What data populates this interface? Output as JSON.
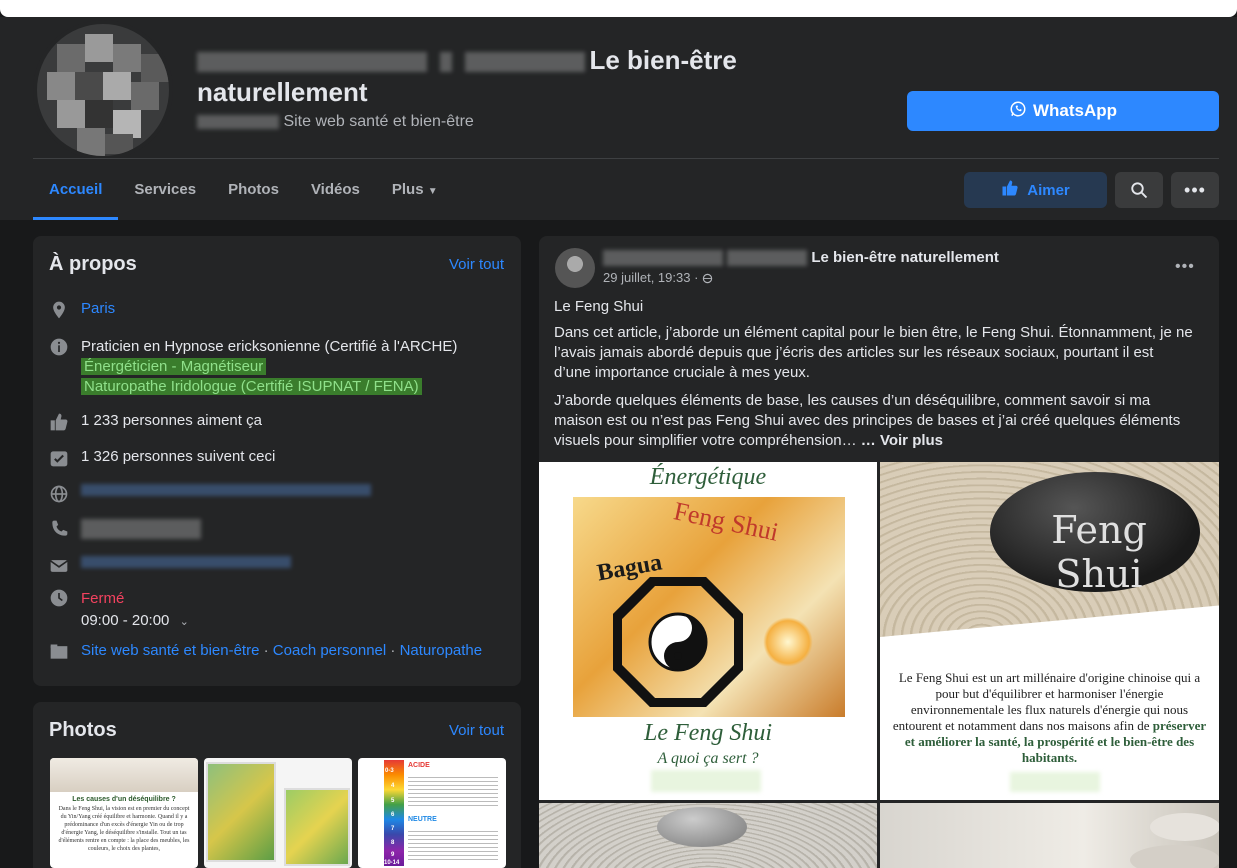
{
  "header": {
    "page_title_suffix": "Le bien-être",
    "page_title_line2": "naturellement",
    "category": "Site web santé et bien-être",
    "whatsapp_label": "WhatsApp",
    "like_label": "Aimer"
  },
  "tabs": [
    {
      "label": "Accueil"
    },
    {
      "label": "Services"
    },
    {
      "label": "Photos"
    },
    {
      "label": "Vidéos"
    },
    {
      "label": "Plus"
    }
  ],
  "about": {
    "title": "À propos",
    "see_all": "Voir tout",
    "location": "Paris",
    "description_line1": "Praticien en Hypnose ericksonienne (Certifié à l'ARCHE)",
    "description_line2": "Énergéticien - Magnétiseur",
    "description_line3": "Naturopathe Iridologue (Certifié ISUPNAT / FENA)",
    "likes": "1 233 personnes aiment ça",
    "followers": "1 326 personnes suivent ceci",
    "status": "Fermé",
    "hours": "09:00 - 20:00",
    "categories": [
      "Site web santé et bien-être",
      "Coach personnel",
      "Naturopathe"
    ],
    "separator": "·"
  },
  "photos": {
    "title": "Photos",
    "see_all": "Voir tout"
  },
  "post": {
    "author_suffix": "Le bien-être naturellement",
    "date": "29 juillet, 19:33 ·",
    "title": "Le Feng Shui",
    "para1": "Dans cet article, j’aborde un élément capital pour le bien être, le Feng Shui. Étonnamment, je ne l’avais jamais abordé depuis que j’écris des articles sur les réseaux sociaux, pourtant il est d’une importance cruciale à mes yeux.",
    "para2": "J’aborde quelques éléments de base, les causes d’un déséquilibre, comment savoir si ma maison est ou n’est pas Feng Shui avec des principes de bases et j’ai créé quelques éléments visuels pour simplifier votre compréhension… ",
    "see_more": "… Voir plus",
    "img1_top": "Énergétique",
    "img1_fengshui": "Feng Shui",
    "img1_bagua": "Bagua",
    "img1_bottom": "Le Feng Shui",
    "img1_bottom2": "A quoi ça sert ?",
    "img2_stone": "Feng Shui",
    "img2_text": "Le Feng Shui est un art millénaire d'origine chinoise qui a pour but d'équilibrer et harmoniser l'énergie environnementale les flux naturels d'énergie qui nous entourent et notamment dans nos maisons afin de",
    "img2_bold": "préserver et améliorer la santé, la prospérité et le bien-être des habitants."
  },
  "thumbs": {
    "t1_title": "Les causes d'un déséquilibre ?",
    "t1_text": "Dans le Feng Shui, la vision est en premier du concept du Yin/Yang créé équilibre et harmonie. Quand il y a prédominance d'un excès d'énergie Yin ou de trop d'énergie Yang, le déséquilibre s'installe. Tout un tas d'éléments rentre en compte : la place des meubles, les couleurs, le choix des plantes,",
    "t3_scale": [
      "0-3",
      "4",
      "5",
      "6",
      "7",
      "8",
      "9",
      "10-14"
    ],
    "t3_acide": "ACIDE",
    "t3_neutre": "NEUTRE"
  },
  "colors": {
    "accent": "#2d88ff",
    "background": "#18191a",
    "surface": "#242526",
    "closed": "#f3425f"
  }
}
